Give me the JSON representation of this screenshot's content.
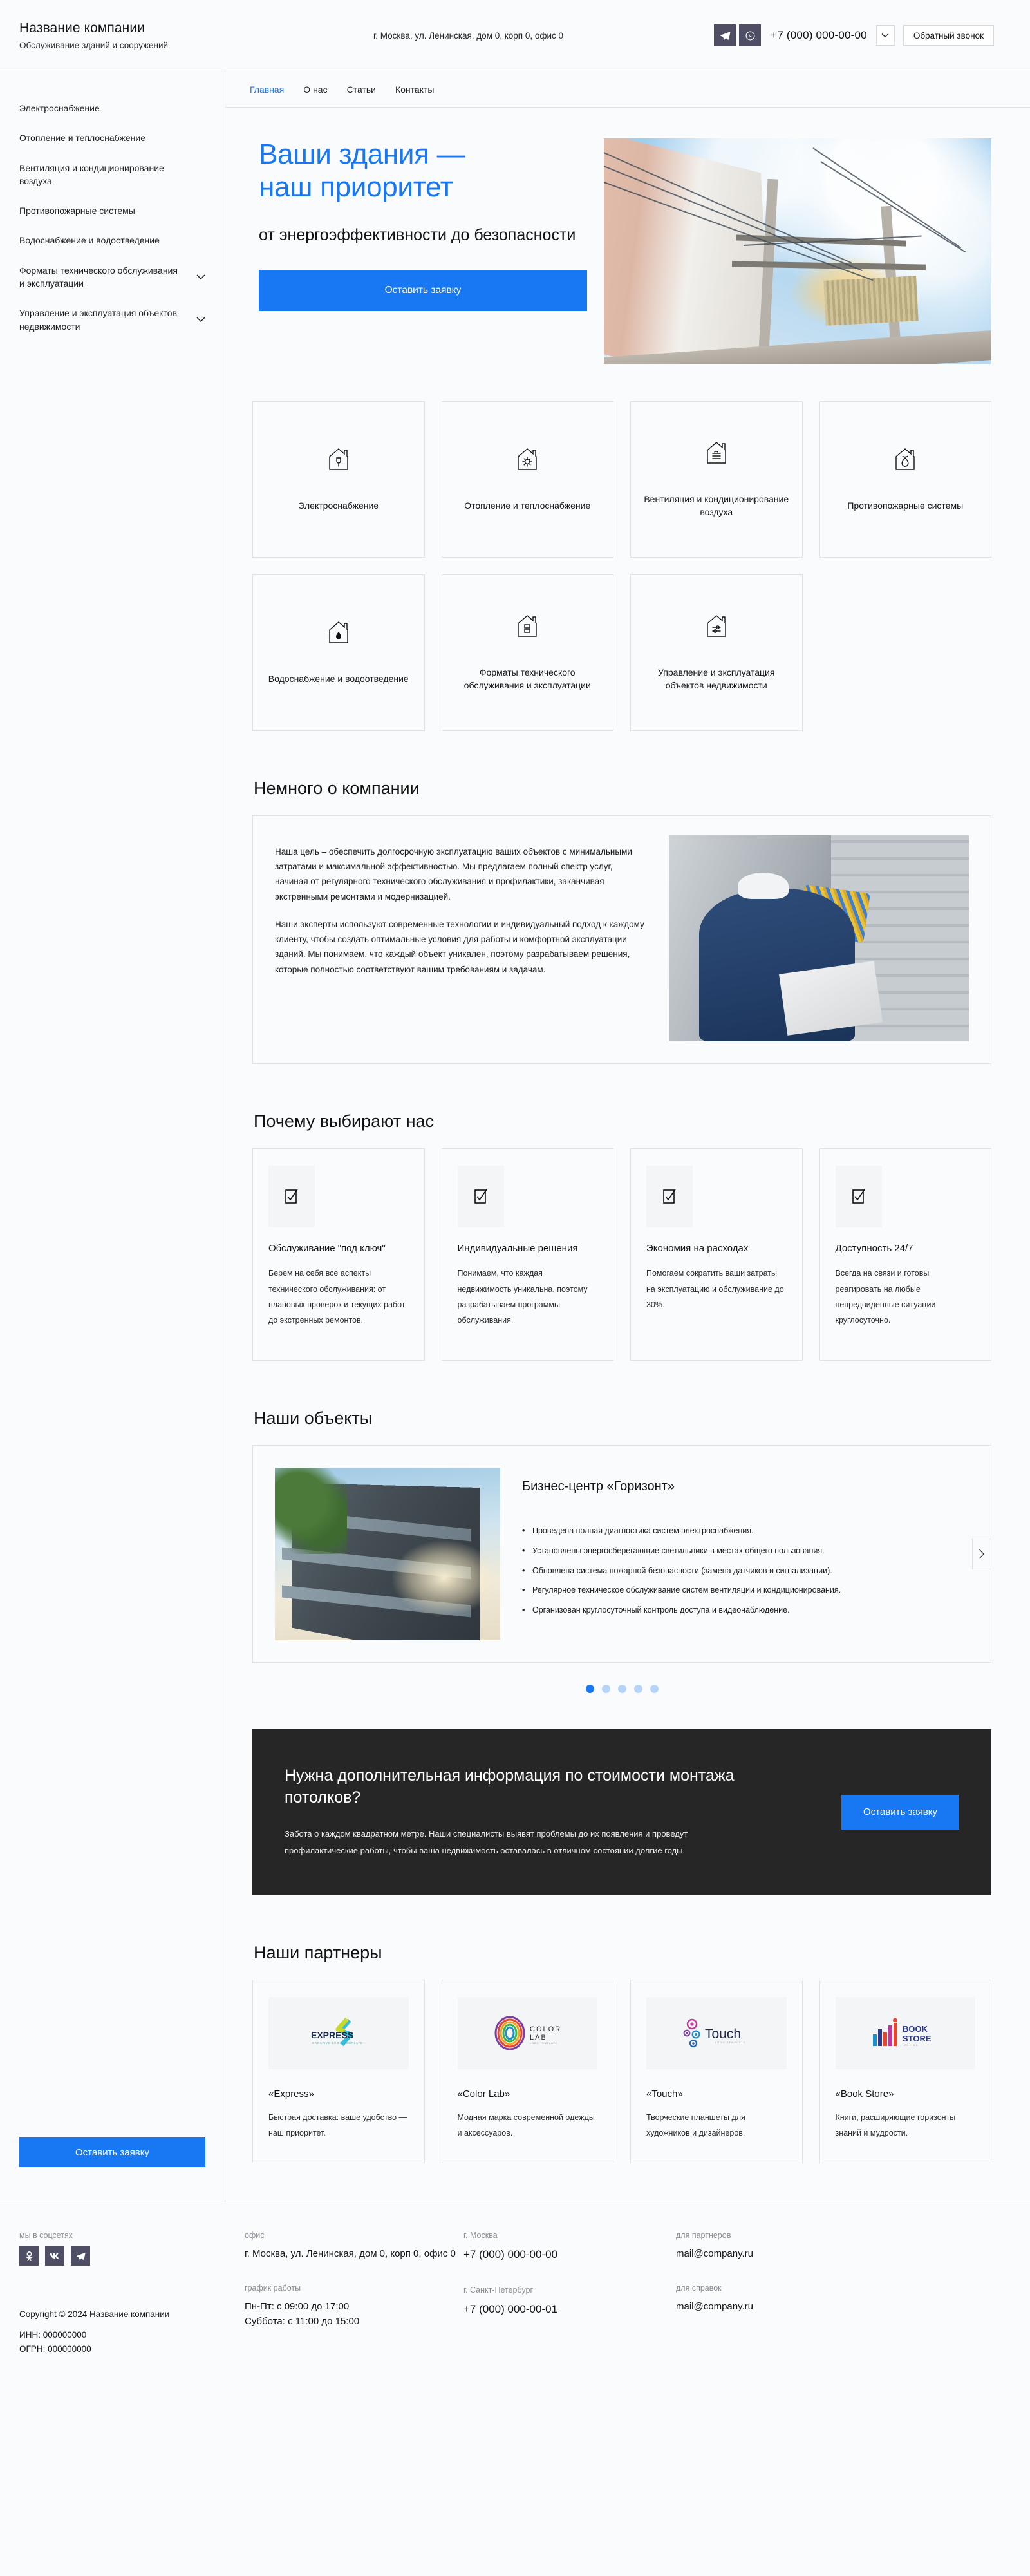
{
  "header": {
    "company_name": "Название компании",
    "tagline": "Обслуживание зданий и сооружений",
    "address": "г. Москва, ул. Ленинская, дом 0, корп 0, офис 0",
    "phone": "+7 (000) 000-00-00",
    "callback_label": "Обратный звонок",
    "telegram_icon": "telegram-icon",
    "whatsapp_icon": "whatsapp-icon",
    "chevron_icon": "chevron-down-icon"
  },
  "sidebar": {
    "items": [
      {
        "label": "Электроснабжение",
        "expandable": false
      },
      {
        "label": "Отопление и теплоснабжение",
        "expandable": false
      },
      {
        "label": "Вентиляция и кондиционирование воздуха",
        "expandable": false
      },
      {
        "label": "Противопожарные системы",
        "expandable": false
      },
      {
        "label": "Водоснабжение и водоотведение",
        "expandable": false
      },
      {
        "label": "Форматы технического обслуживания и эксплуатации",
        "expandable": true
      },
      {
        "label": "Управление и эксплуатация объектов недвижимости",
        "expandable": true
      }
    ],
    "cta_label": "Оставить заявку"
  },
  "nav": {
    "tabs": [
      {
        "label": "Главная",
        "active": true
      },
      {
        "label": "О нас",
        "active": false
      },
      {
        "label": "Статьи",
        "active": false
      },
      {
        "label": "Контакты",
        "active": false
      }
    ]
  },
  "hero": {
    "title_line1": "Ваши здания —",
    "title_line2": "наш приоритет",
    "subtitle": "от энергоэффективности до безопасности",
    "cta_label": "Оставить заявку",
    "image_alt": "electrical-infrastructure-photo"
  },
  "services": {
    "cards": [
      {
        "label": "Электроснабжение",
        "icon": "house-plug-icon"
      },
      {
        "label": "Отопление и теплоснабжение",
        "icon": "house-sun-icon"
      },
      {
        "label": "Вентиляция и кондиционирование воздуха",
        "icon": "house-air-icon"
      },
      {
        "label": "Противопожарные системы",
        "icon": "house-flame-icon"
      },
      {
        "label": "Водоснабжение и водоотведение",
        "icon": "house-drop-icon"
      },
      {
        "label": "Форматы технического обслуживания и эксплуатации",
        "icon": "house-building-icon"
      },
      {
        "label": "Управление и эксплуатация объектов недвижимости",
        "icon": "house-settings-icon"
      }
    ]
  },
  "about": {
    "title": "Немного о компании",
    "paragraph1": "Наша цель – обеспечить долгосрочную эксплуатацию ваших объектов с минимальными затратами и максимальной эффективностью. Мы предлагаем полный спектр услуг, начиная от регулярного технического обслуживания и профилактики, заканчивая экстренными ремонтами и модернизацией.",
    "paragraph2": "Наши эксперты используют современные технологии и индивидуальный подход к каждому клиенту, чтобы создать оптимальные условия для работы и комфортной эксплуатации зданий. Мы понимаем, что каждый объект уникален, поэтому разрабатываем решения, которые полностью соответствуют вашим требованиям и задачам.",
    "image_alt": "engineer-checking-electrical-panel-photo"
  },
  "why": {
    "title": "Почему выбирают нас",
    "cards": [
      {
        "title": "Обслуживание \"под ключ\"",
        "desc": "Берем на себя все аспекты технического обслуживания: от плановых проверок и текущих работ до экстренных ремонтов.",
        "icon": "checkbox-check-icon"
      },
      {
        "title": "Индивидуальные решения",
        "desc": "Понимаем, что каждая недвижимость уникальна, поэтому разрабатываем программы обслуживания.",
        "icon": "checkbox-check-icon"
      },
      {
        "title": "Экономия на расходах",
        "desc": "Помогаем сократить ваши затраты на эксплуатацию и обслуживание до 30%.",
        "icon": "checkbox-check-icon"
      },
      {
        "title": "Доступность 24/7",
        "desc": "Всегда на связи и готовы реагировать на любые непредвиденные ситуации круглосуточно.",
        "icon": "checkbox-check-icon"
      }
    ]
  },
  "objects": {
    "title": "Наши объекты",
    "current": {
      "name": "Бизнес-центр «Горизонт»",
      "image_alt": "modern-office-building-photo",
      "bullets": [
        "Проведена полная диагностика систем электроснабжения.",
        "Установлены энергосберегающие светильники в местах общего пользования.",
        "Обновлена система пожарной безопасности (замена датчиков и сигнализации).",
        "Регулярное техническое обслуживание систем вентиляции и кондиционирования.",
        "Организован круглосуточный контроль доступа и видеонаблюдение."
      ]
    },
    "next_arrow_icon": "chevron-right-icon",
    "dots_total": 5,
    "dots_active_index": 0
  },
  "dark_cta": {
    "heading": "Нужна дополнительная информация по стоимости монтажа потолков?",
    "body": "Забота о каждом квадратном метре. Наши специалисты выявят проблемы до их появления и проведут профилактические работы, чтобы ваша недвижимость оставалась в отличном состоянии долгие годы.",
    "button_label": "Оставить заявку"
  },
  "partners": {
    "title": "Наши партнеры",
    "cards": [
      {
        "name": "«Express»",
        "desc": "Быстрая доставка: ваше удобство — наш приоритет.",
        "logo": "express-logo",
        "logo_text": "EXPRESS"
      },
      {
        "name": "«Color Lab»",
        "desc": "Модная марка современной одежды и аксессуаров.",
        "logo": "color-lab-logo",
        "logo_text": "COLOR LAB"
      },
      {
        "name": "«Touch»",
        "desc": "Творческие планшеты для художников и дизайнеров.",
        "logo": "touch-logo",
        "logo_text": "Touch"
      },
      {
        "name": "«Book Store»",
        "desc": "Книги, расширяющие горизонты знаний и мудрости.",
        "logo": "book-store-logo",
        "logo_text": "BOOK STORE"
      }
    ]
  },
  "footer": {
    "social_label": "мы в соцсетях",
    "social_icons": [
      "odnoklassniki-icon",
      "vkontakte-icon",
      "telegram-icon"
    ],
    "office_label": "офис",
    "office_address": "г. Москва, ул. Ленинская, дом 0, корп 0, офис 0",
    "schedule_label": "график работы",
    "schedule_weekdays": "Пн-Пт: с 09:00 до 17:00",
    "schedule_saturday": "Суббота: с 11:00 до 15:00",
    "moscow_label": "г. Москва",
    "moscow_phone": "+7  (000) 000-00-00",
    "spb_label": "г. Санкт-Петербург",
    "spb_phone": "+7 (000) 000-00-01",
    "partners_label": "для партнеров",
    "partners_email": "mail@company.ru",
    "info_label": "для справок",
    "info_email": "mail@company.ru",
    "copyright": "Copyright © 2024 Название компании",
    "inn": "ИНН: 000000000",
    "ogrn": "ОГРН: 000000000"
  },
  "colors": {
    "accent": "#1877f2",
    "dark_panel": "#262626",
    "social_square": "#4e4e65",
    "page_bg": "#fafbfc",
    "border": "#dfe2e6"
  }
}
